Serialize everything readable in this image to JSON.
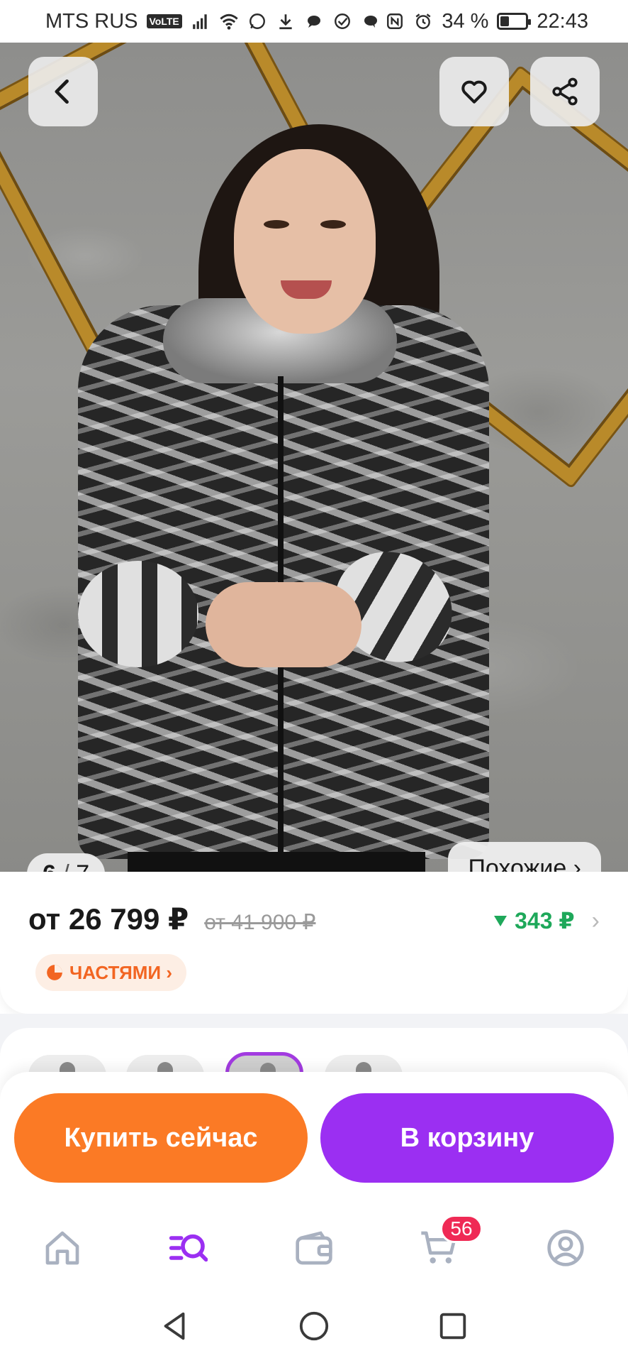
{
  "status_bar": {
    "carrier": "MTS RUS",
    "volte": "VoLTE",
    "battery": "34 %",
    "battery_level": 0.34,
    "time": "22:43"
  },
  "gallery": {
    "current": "6",
    "total": "7",
    "similar_label": "Похожие ›"
  },
  "price": {
    "current": "от 26 799 ₽",
    "old": "от 41 900 ₽",
    "cashback": "343 ₽",
    "installments_label": "ЧАСТЯМИ ›"
  },
  "actions": {
    "buy_now": "Купить сейчас",
    "add_to_cart": "В корзину"
  },
  "tabbar": {
    "items": [
      "home-icon",
      "catalog-search-icon",
      "wallet-icon",
      "cart-icon",
      "profile-icon"
    ],
    "cart_badge": "56"
  },
  "colors": {
    "buy_now": "#fb7a25",
    "add_to_cart": "#9b2ff2",
    "cashback": "#1ea85a",
    "installments": "#f26522",
    "badge": "#ef2a55"
  }
}
